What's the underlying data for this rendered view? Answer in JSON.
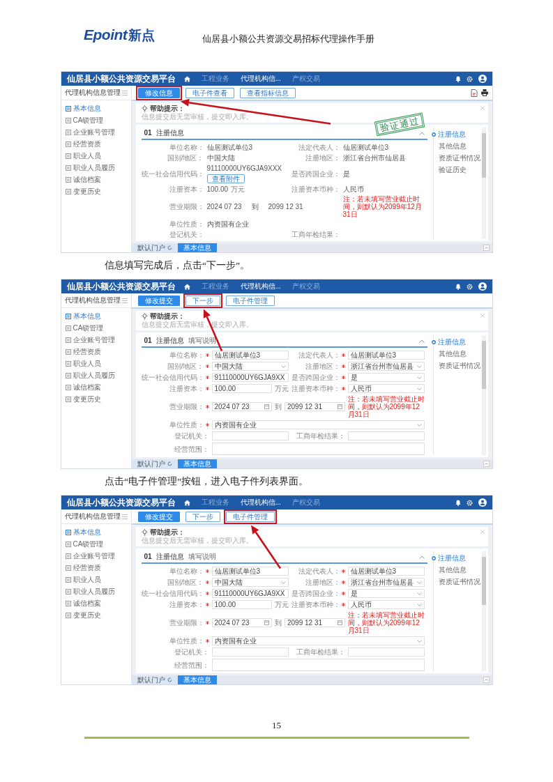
{
  "header": {
    "logo": {
      "wordmark": "Epoint",
      "name": "新点"
    },
    "title": "仙居县小额公共资源交易招标代理操作手册"
  },
  "content": [
    {
      "kind": "screenshot",
      "editing": false,
      "platform": "仙居县小额公共资源交易平台",
      "nav": [
        {
          "label": "工程业务",
          "selected": false
        },
        {
          "label": "代理机构信...",
          "selected": true
        },
        {
          "label": "产权交易",
          "selected": false
        }
      ],
      "sidebar": {
        "title": "代理机构信息管理",
        "items": [
          {
            "label": "基本信息",
            "selected": true
          },
          {
            "label": "CA锁管理",
            "selected": false
          },
          {
            "label": "企业账号管理",
            "selected": false
          },
          {
            "label": "经营资质",
            "selected": false
          },
          {
            "label": "职业人员",
            "selected": false
          },
          {
            "label": "职业人员履历",
            "selected": false
          },
          {
            "label": "诚信档案",
            "selected": false
          },
          {
            "label": "变更历史",
            "selected": false
          }
        ]
      },
      "toolbar": [
        {
          "label": "修改信息",
          "primary": true,
          "highlighted": true
        },
        {
          "label": "电子件查看",
          "primary": false,
          "highlighted": false
        },
        {
          "label": "查看指标信息",
          "primary": false,
          "highlighted": false
        }
      ],
      "help": {
        "title": "帮助提示：",
        "text": "信息提交后无需审核，提交即入库。"
      },
      "stamp": "验证通过",
      "section": {
        "number": "01",
        "title": "注册信息"
      },
      "rows": [
        [
          {
            "label": "单位名称：",
            "kind": "text",
            "value": "仙居测试单位3"
          },
          {
            "label": "法定代表人：",
            "kind": "text",
            "value": "仙居测试单位3"
          }
        ],
        [
          {
            "label": "国别/地区：",
            "kind": "text",
            "value": "中国大陆"
          },
          {
            "label": "注册地区：",
            "kind": "text",
            "value": "浙江省台州市仙居县"
          }
        ],
        [
          {
            "label": "统一社会信用代码：",
            "kind": "text",
            "value": "91110000UY6GJA9XXX",
            "attachment": "查看附件"
          },
          {
            "label": "是否跨国企业：",
            "kind": "text",
            "value": "是"
          }
        ],
        [
          {
            "label": "注册资本：",
            "kind": "text",
            "value": "100.00",
            "unit": "万元"
          },
          {
            "label": "注册资本币种：",
            "kind": "text",
            "value": "人民币"
          }
        ],
        [
          {
            "label": "营业期限：",
            "kind": "period",
            "value": "2024 07 23",
            "to": "到",
            "end": "2099 12 31",
            "note": "注：若未填写营业截止时间，则默认为2099年12月31日"
          }
        ],
        [
          {
            "label": "单位性质：",
            "kind": "text",
            "value": "内资国有企业"
          }
        ],
        [
          {
            "label": "登记机关：",
            "kind": "text"
          },
          {
            "label": "工商年检结果：",
            "kind": "text"
          }
        ]
      ],
      "anchors": [
        {
          "label": "注册信息",
          "selected": true
        },
        {
          "label": "其他信息",
          "selected": false
        },
        {
          "label": "资质证书情况",
          "selected": false
        },
        {
          "label": "验证历史",
          "selected": false
        }
      ],
      "tabs": [
        {
          "label": "默认门户",
          "kind": "portal",
          "selected": false
        },
        {
          "label": "基本信息",
          "kind": "page",
          "selected": true
        }
      ]
    },
    {
      "kind": "paragraph",
      "text": "信息填写完成后，点击“下一步”。"
    },
    {
      "kind": "screenshot",
      "editing": true,
      "platform": "仙居县小额公共资源交易平台",
      "nav": [
        {
          "label": "工程业务",
          "selected": false
        },
        {
          "label": "代理机构信...",
          "selected": true
        },
        {
          "label": "产权交易",
          "selected": false
        }
      ],
      "sidebar": {
        "title": "代理机构信息管理",
        "items": [
          {
            "label": "基本信息",
            "selected": true
          },
          {
            "label": "CA锁管理",
            "selected": false
          },
          {
            "label": "企业账号管理",
            "selected": false
          },
          {
            "label": "经营资质",
            "selected": false
          },
          {
            "label": "职业人员",
            "selected": false
          },
          {
            "label": "职业人员履历",
            "selected": false
          },
          {
            "label": "诚信档案",
            "selected": false
          },
          {
            "label": "变更历史",
            "selected": false
          }
        ]
      },
      "toolbar": [
        {
          "label": "修改提交",
          "primary": true,
          "highlighted": false
        },
        {
          "label": "下一步",
          "primary": false,
          "highlighted": true
        },
        {
          "label": "电子件管理",
          "primary": false,
          "highlighted": false
        }
      ],
      "help": {
        "title": "帮助提示：",
        "text": "信息提交后无需审核，提交即入库。"
      },
      "section": {
        "number": "01",
        "title": "注册信息",
        "subtitle": "填写说明"
      },
      "rows": [
        [
          {
            "label": "单位名称：",
            "kind": "input",
            "required": true,
            "value": "仙居测试单位3"
          },
          {
            "label": "法定代表人：",
            "kind": "input",
            "required": true,
            "value": "仙居测试单位3"
          }
        ],
        [
          {
            "label": "国别/地区：",
            "kind": "select",
            "required": true,
            "value": "中国大陆"
          },
          {
            "label": "注册地区：",
            "kind": "select",
            "required": true,
            "value": "浙江省台州市仙居县"
          }
        ],
        [
          {
            "label": "统一社会信用代码：",
            "kind": "input",
            "required": true,
            "value": "91110000UY6GJA9XX"
          },
          {
            "label": "是否跨国企业：",
            "kind": "select",
            "required": true,
            "value": "是"
          }
        ],
        [
          {
            "label": "注册资本：",
            "kind": "input",
            "required": true,
            "value": "100.00",
            "unit": "万元"
          },
          {
            "label": "注册资本币种：",
            "kind": "select",
            "required": true,
            "value": "人民币"
          }
        ],
        [
          {
            "label": "营业期限：",
            "kind": "date_range",
            "required": true,
            "value": "2024 07 23",
            "to": "到",
            "end": "2099 12 31",
            "note": "注：若未填写营业截止时间，则默认为2099年12月31日"
          }
        ],
        [
          {
            "label": "单位性质：",
            "kind": "select",
            "required": true,
            "value": "内资国有企业"
          }
        ],
        [
          {
            "label": "登记机关：",
            "kind": "input",
            "required": false
          },
          {
            "label": "工商年检结果：",
            "kind": "input",
            "required": false
          }
        ],
        [
          {
            "label": "经营范围：",
            "kind": "textarea",
            "required": false
          }
        ]
      ],
      "anchors": [
        {
          "label": "注册信息",
          "selected": true
        },
        {
          "label": "其他信息",
          "selected": false
        },
        {
          "label": "资质证书情况",
          "selected": false
        }
      ],
      "tabs": [
        {
          "label": "默认门户",
          "kind": "portal",
          "selected": false
        },
        {
          "label": "基本信息",
          "kind": "page",
          "selected": true
        }
      ]
    },
    {
      "kind": "paragraph",
      "text": "点击“电子件管理”按钮，进入电子件列表界面。"
    },
    {
      "kind": "screenshot",
      "editing": true,
      "platform": "仙居县小额公共资源交易平台",
      "nav": [
        {
          "label": "工程业务",
          "selected": false
        },
        {
          "label": "代理机构信...",
          "selected": true
        },
        {
          "label": "产权交易",
          "selected": false
        }
      ],
      "sidebar": {
        "title": "代理机构信息管理",
        "items": [
          {
            "label": "基本信息",
            "selected": true
          },
          {
            "label": "CA锁管理",
            "selected": false
          },
          {
            "label": "企业账号管理",
            "selected": false
          },
          {
            "label": "经营资质",
            "selected": false
          },
          {
            "label": "职业人员",
            "selected": false
          },
          {
            "label": "职业人员履历",
            "selected": false
          },
          {
            "label": "诚信档案",
            "selected": false
          },
          {
            "label": "变更历史",
            "selected": false
          }
        ]
      },
      "toolbar": [
        {
          "label": "修改提交",
          "primary": true,
          "highlighted": false
        },
        {
          "label": "下一步",
          "primary": false,
          "highlighted": false
        },
        {
          "label": "电子件管理",
          "primary": false,
          "highlighted": true
        }
      ],
      "help": {
        "title": "帮助提示：",
        "text": "信息提交后无需审核，提交即入库。"
      },
      "section": {
        "number": "01",
        "title": "注册信息",
        "subtitle": "填写说明"
      },
      "rows": [
        [
          {
            "label": "单位名称：",
            "kind": "input",
            "required": true,
            "value": "仙居测试单位3"
          },
          {
            "label": "法定代表人：",
            "kind": "input",
            "required": true,
            "value": "仙居测试单位3"
          }
        ],
        [
          {
            "label": "国别/地区：",
            "kind": "select",
            "required": true,
            "value": "中国大陆"
          },
          {
            "label": "注册地区：",
            "kind": "select",
            "required": true,
            "value": "浙江省台州市仙居县"
          }
        ],
        [
          {
            "label": "统一社会信用代码：",
            "kind": "input",
            "required": true,
            "value": "91110000UY6GJA9XX"
          },
          {
            "label": "是否跨国企业：",
            "kind": "select",
            "required": true,
            "value": "是"
          }
        ],
        [
          {
            "label": "注册资本：",
            "kind": "input",
            "required": true,
            "value": "100.00",
            "unit": "万元"
          },
          {
            "label": "注册资本币种：",
            "kind": "select",
            "required": true,
            "value": "人民币"
          }
        ],
        [
          {
            "label": "营业期限：",
            "kind": "date_range",
            "required": true,
            "value": "2024 07 23",
            "to": "到",
            "end": "2099 12 31",
            "note": "注：若未填写营业截止时间，则默认为2099年12月31日"
          }
        ],
        [
          {
            "label": "单位性质：",
            "kind": "select",
            "required": true,
            "value": "内资国有企业"
          }
        ],
        [
          {
            "label": "登记机关：",
            "kind": "input",
            "required": false
          },
          {
            "label": "工商年检结果：",
            "kind": "input",
            "required": false
          }
        ],
        [
          {
            "label": "经营范围：",
            "kind": "textarea",
            "required": false
          }
        ]
      ],
      "anchors": [
        {
          "label": "注册信息",
          "selected": true
        },
        {
          "label": "其他信息",
          "selected": false
        },
        {
          "label": "资质证书情况",
          "selected": false
        }
      ],
      "tabs": [
        {
          "label": "默认门户",
          "kind": "portal",
          "selected": false
        },
        {
          "label": "基本信息",
          "kind": "page",
          "selected": true
        }
      ]
    }
  ],
  "footer": {
    "page": "15"
  }
}
